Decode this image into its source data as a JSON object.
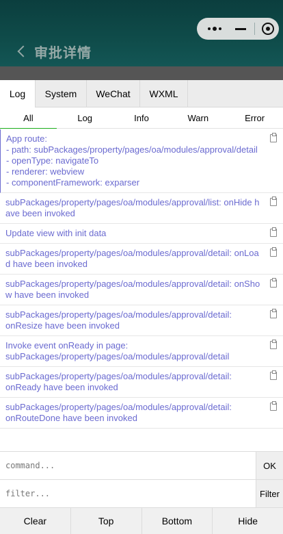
{
  "app": {
    "page_title": "审批详情",
    "colors": {
      "header": "#0f4c4a",
      "log_text": "#6a6ad0",
      "active_underline": "#1aad19"
    }
  },
  "console": {
    "tabs": [
      {
        "label": "Log",
        "active": true
      },
      {
        "label": "System",
        "active": false
      },
      {
        "label": "WeChat",
        "active": false
      },
      {
        "label": "WXML",
        "active": false
      }
    ],
    "subtabs": [
      {
        "label": "All",
        "active": true
      },
      {
        "label": "Log",
        "active": false
      },
      {
        "label": "Info",
        "active": false
      },
      {
        "label": "Warn",
        "active": false
      },
      {
        "label": "Error",
        "active": false
      }
    ],
    "logs": [
      "App route:\n- path: subPackages/property/pages/oa/modules/approval/detail\n- openType: navigateTo\n- renderer: webview\n- componentFramework: exparser",
      "subPackages/property/pages/oa/modules/approval/list: onHide have been invoked",
      "Update view with init data",
      "subPackages/property/pages/oa/modules/approval/detail: onLoad have been invoked",
      "subPackages/property/pages/oa/modules/approval/detail: onShow have been invoked",
      "subPackages/property/pages/oa/modules/approval/detail:\nonResize have been invoked",
      "Invoke event onReady in page:\nsubPackages/property/pages/oa/modules/approval/detail",
      "subPackages/property/pages/oa/modules/approval/detail:\nonReady have been invoked",
      "subPackages/property/pages/oa/modules/approval/detail:\nonRouteDone have been invoked"
    ],
    "command": {
      "placeholder": "command...",
      "value": "",
      "ok_label": "OK"
    },
    "filter": {
      "placeholder": "filter...",
      "value": "",
      "filter_label": "Filter"
    },
    "bottom_buttons": [
      "Clear",
      "Top",
      "Bottom",
      "Hide"
    ]
  }
}
